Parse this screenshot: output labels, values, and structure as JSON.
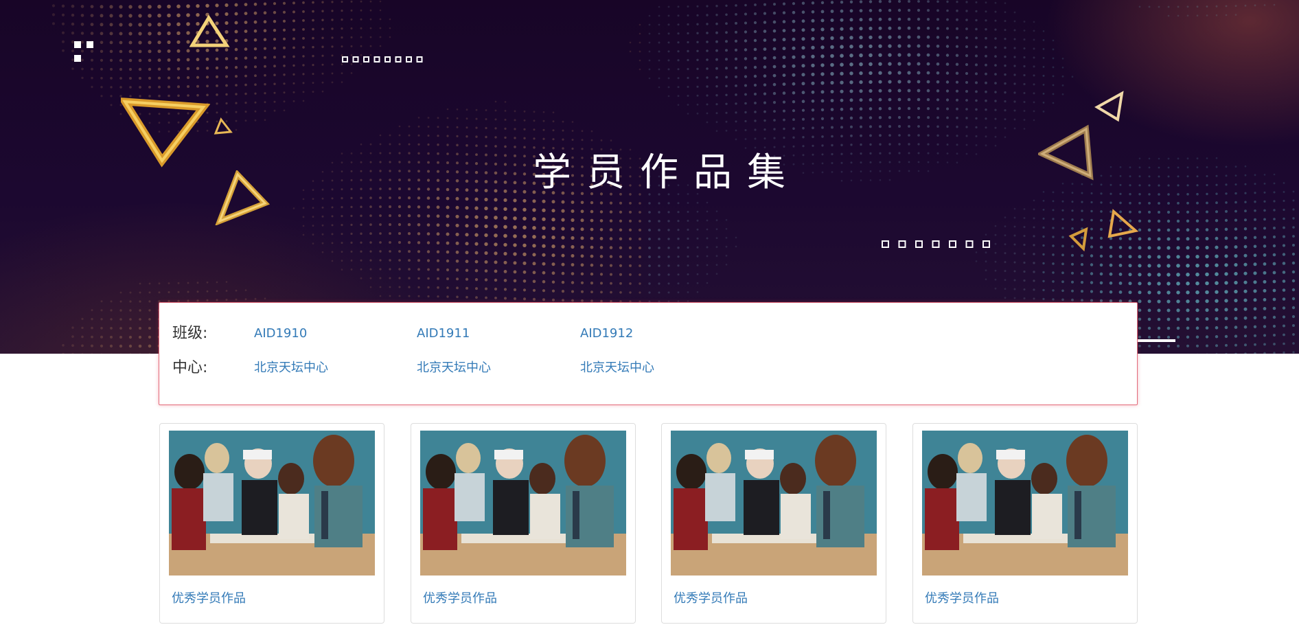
{
  "hero": {
    "title": "学员作品集"
  },
  "filters": {
    "class_row": {
      "label": "班级:",
      "options": [
        "AID1910",
        "AID1911",
        "AID1912"
      ]
    },
    "center_row": {
      "label": "中心:",
      "options": [
        "北京天坛中心",
        "北京天坛中心",
        "北京天坛中心"
      ]
    }
  },
  "cards": [
    {
      "title": "优秀学员作品"
    },
    {
      "title": "优秀学员作品"
    },
    {
      "title": "优秀学员作品"
    },
    {
      "title": "优秀学员作品"
    }
  ],
  "colors": {
    "link": "#337ab7",
    "hero_bg": "#1a062c",
    "panel_border": "#e36a7a",
    "gold_accent": "#e0a640"
  }
}
